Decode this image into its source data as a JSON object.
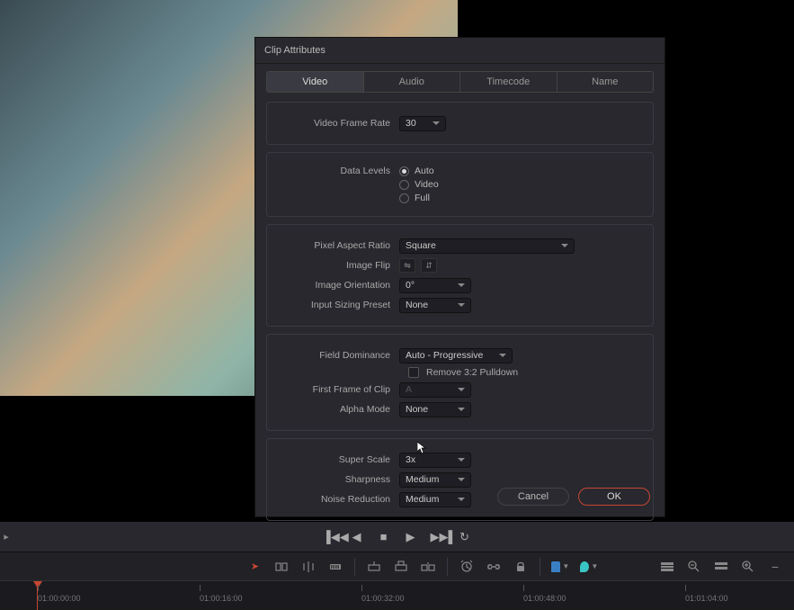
{
  "dialog": {
    "title": "Clip Attributes",
    "tabs": [
      "Video",
      "Audio",
      "Timecode",
      "Name"
    ],
    "activeTab": 0,
    "videoFrameRate": {
      "label": "Video Frame Rate",
      "value": "30"
    },
    "dataLevels": {
      "label": "Data Levels",
      "options": [
        "Auto",
        "Video",
        "Full"
      ],
      "selected": 0
    },
    "pixelAspectRatio": {
      "label": "Pixel Aspect Ratio",
      "value": "Square"
    },
    "imageFlip": {
      "label": "Image Flip"
    },
    "imageOrientation": {
      "label": "Image Orientation",
      "value": "0°"
    },
    "inputSizingPreset": {
      "label": "Input Sizing Preset",
      "value": "None"
    },
    "fieldDominance": {
      "label": "Field Dominance",
      "value": "Auto - Progressive"
    },
    "removePulldown": {
      "label": "Remove 3:2 Pulldown",
      "checked": false
    },
    "firstFrameOfClip": {
      "label": "First Frame of Clip",
      "value": "A"
    },
    "alphaMode": {
      "label": "Alpha Mode",
      "value": "None"
    },
    "superScale": {
      "label": "Super Scale",
      "value": "3x"
    },
    "sharpness": {
      "label": "Sharpness",
      "value": "Medium"
    },
    "noiseReduction": {
      "label": "Noise Reduction",
      "value": "Medium"
    },
    "buttons": {
      "cancel": "Cancel",
      "ok": "OK"
    }
  },
  "timeline": {
    "ticks": [
      "01:00:00:00",
      "01:00:16:00",
      "01:00:32:00",
      "01:00:48:00",
      "01:01:04:00"
    ]
  }
}
